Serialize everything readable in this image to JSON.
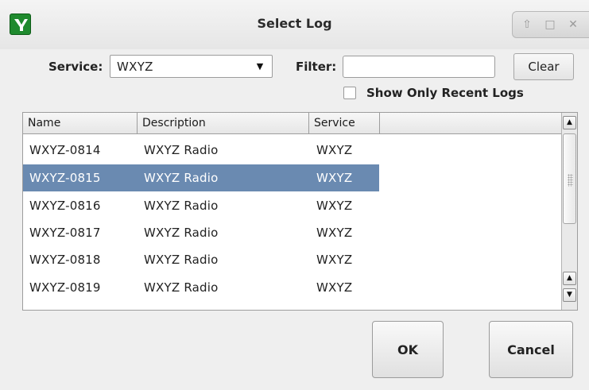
{
  "window": {
    "title": "Select Log",
    "controls": [
      "up-icon",
      "maximize-icon",
      "close-icon"
    ]
  },
  "form": {
    "service_label": "Service:",
    "service_value": "WXYZ",
    "filter_label": "Filter:",
    "filter_value": "",
    "clear_label": "Clear",
    "recent_label": "Show Only Recent Logs",
    "recent_checked": false
  },
  "table": {
    "columns": [
      "Name",
      "Description",
      "Service",
      ""
    ],
    "rows": [
      {
        "name": "WXYZ-0814",
        "description": "WXYZ Radio",
        "service": "WXYZ",
        "selected": false
      },
      {
        "name": "WXYZ-0815",
        "description": "WXYZ Radio",
        "service": "WXYZ",
        "selected": true
      },
      {
        "name": "WXYZ-0816",
        "description": "WXYZ Radio",
        "service": "WXYZ",
        "selected": false
      },
      {
        "name": "WXYZ-0817",
        "description": "WXYZ Radio",
        "service": "WXYZ",
        "selected": false
      },
      {
        "name": "WXYZ-0818",
        "description": "WXYZ Radio",
        "service": "WXYZ",
        "selected": false
      },
      {
        "name": "WXYZ-0819",
        "description": "WXYZ Radio",
        "service": "WXYZ",
        "selected": false
      }
    ]
  },
  "buttons": {
    "ok": "OK",
    "cancel": "Cancel"
  },
  "colors": {
    "selection": "#6a8ab1",
    "app_icon": "#1f8a2e"
  }
}
